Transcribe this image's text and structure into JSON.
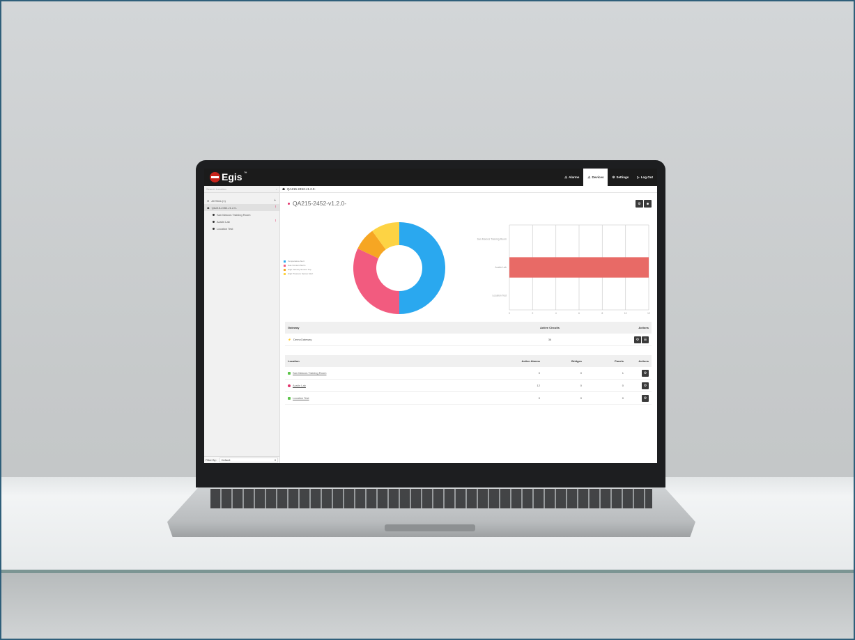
{
  "app": {
    "logo_text": "Egis",
    "logo_tm": "™"
  },
  "nav": [
    {
      "label": "Alarms",
      "icon": "alarm-icon"
    },
    {
      "label": "Devices",
      "icon": "devices-icon",
      "active": true
    },
    {
      "label": "Settings",
      "icon": "gear-icon"
    },
    {
      "label": "Log Out",
      "icon": "logout-icon"
    }
  ],
  "sidebar": {
    "search_placeholder": "Search Location",
    "search_clear": "×",
    "items": [
      {
        "label": "All Sites (1)",
        "right": "+",
        "level": 0
      },
      {
        "label": "QA215-2452-v1.2.0-",
        "right": "!",
        "level": 0,
        "selected": true
      },
      {
        "label": "San Marcos Training Room",
        "right": "",
        "level": 1
      },
      {
        "label": "Austin Lab",
        "right": "!",
        "level": 1
      },
      {
        "label": "Location Test",
        "right": "",
        "level": 1
      }
    ],
    "filter_label": "Filter By:",
    "filter_value": "Default"
  },
  "breadcrumb": "QA215-2452-v1.2.0-",
  "page_title": "QA215-2452-v1.2.0-",
  "colors": {
    "blue": "#2aa8ef",
    "pink": "#f25b7f",
    "orange": "#f6a623",
    "yellow": "#fdd344",
    "bar_red": "#e86a66",
    "green": "#5cc449"
  },
  "chart_data": [
    {
      "type": "pie",
      "legend": [
        "Temperature Alert",
        "Gas Content Alarm",
        "High Velocity Sensor Trip",
        "High Pressure Sensor Alert"
      ],
      "values": [
        50,
        32,
        8,
        10
      ]
    },
    {
      "type": "bar",
      "orientation": "horizontal",
      "categories": [
        "San Marcos Training Room",
        "Austin Lab",
        "Location Test"
      ],
      "values": [
        0,
        12,
        0
      ],
      "xlim": [
        0,
        12
      ],
      "x_ticks": [
        "0",
        "2",
        "4",
        "6",
        "8",
        "10",
        "12"
      ],
      "grid": true
    }
  ],
  "gateway_table": {
    "headers": [
      "Gateway",
      "Active Circuits",
      "Actions"
    ],
    "rows": [
      {
        "name": "DemoGateway",
        "circuits": "36"
      }
    ]
  },
  "location_table": {
    "headers": [
      "Location",
      "Active Alarms",
      "Bridges",
      "Panels",
      "Actions"
    ],
    "rows": [
      {
        "name": "San Marcos Training Room",
        "alarms": "0",
        "bridges": "0",
        "panels": "1",
        "status": "green"
      },
      {
        "name": "Austin Lab",
        "alarms": "12",
        "bridges": "0",
        "panels": "0",
        "status": "pink"
      },
      {
        "name": "Location Test",
        "alarms": "0",
        "bridges": "0",
        "panels": "0",
        "status": "green"
      }
    ]
  }
}
